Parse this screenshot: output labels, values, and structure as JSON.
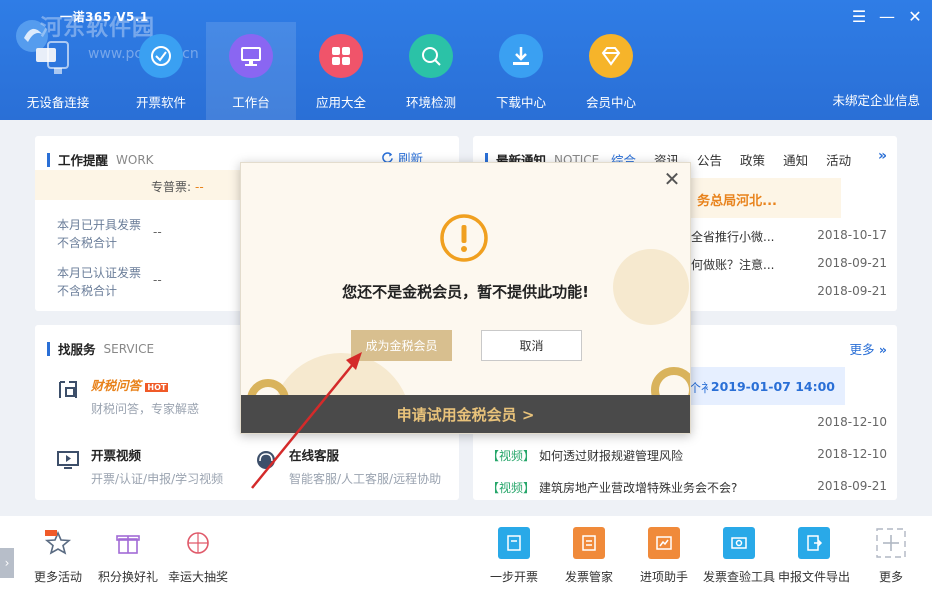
{
  "app": {
    "title": "一诺365 V5.1",
    "watermark": "河东软件园",
    "watermark_url": "www.pc0359.cn",
    "company_status": "未绑定企业信息"
  },
  "window_controls": {
    "menu": "☰",
    "minimize": "—",
    "close": "✕"
  },
  "nav": [
    {
      "label": "无设备连接",
      "icon": "device-icon"
    },
    {
      "label": "开票软件",
      "icon": "invoice-software-icon",
      "color": "#2f8fe8"
    },
    {
      "label": "工作台",
      "icon": "workbench-icon",
      "color": "#7b5cf0"
    },
    {
      "label": "应用大全",
      "icon": "apps-icon",
      "color": "#f0546a"
    },
    {
      "label": "环境检测",
      "icon": "env-check-icon",
      "color": "#2bc2a7"
    },
    {
      "label": "下载中心",
      "icon": "download-icon",
      "color": "#2f8fe8"
    },
    {
      "label": "会员中心",
      "icon": "vip-icon",
      "color": "#f6b42a"
    }
  ],
  "work": {
    "title": "工作提醒",
    "title_en": "WORK",
    "refresh": "刷新",
    "ticket_label": "专普票:",
    "ticket_value": "--",
    "stats": [
      {
        "line1": "本月已开具发票",
        "line2": "不含税合计",
        "value": "--"
      },
      {
        "line1": "本月已认证发票",
        "line2": "不含税合计",
        "value": "--"
      }
    ]
  },
  "service": {
    "title": "找服务",
    "title_en": "SERVICE",
    "items": [
      {
        "name": "财税问答",
        "badge": "HOT",
        "desc": "财税问答，专家解惑"
      },
      {
        "name": "开票视频",
        "desc": "开票/认证/申报/学习视频"
      },
      {
        "name": "在线客服",
        "desc": "智能客服/人工客服/远程协助"
      }
    ]
  },
  "notice": {
    "title": "最新通知",
    "title_en": "NOTICE",
    "tabs": [
      "综合",
      "资讯",
      "公告",
      "政策",
      "通知",
      "活动"
    ],
    "more": "»",
    "banner": "务总局河北...",
    "rows": [
      {
        "text": "全省推行小微...",
        "date": "2018-10-17"
      },
      {
        "text": "何做账？注意...",
        "date": "2018-09-21"
      },
      {
        "text": "",
        "date": "2018-09-21"
      }
    ]
  },
  "news": {
    "more": "更多",
    "live_marker": "个衤",
    "live_time": "2019-01-07 14:00",
    "rows": [
      {
        "tag": "",
        "text": "",
        "date": "2018-12-10"
      },
      {
        "tag": "【视频】",
        "text": "如何透过财报规避管理风险",
        "date": "2018-12-10"
      },
      {
        "tag": "【视频】",
        "text": "建筑房地产业营改增特殊业务会不会?",
        "date": "2018-09-21"
      }
    ]
  },
  "bottom_left": [
    {
      "label": "更多活动",
      "icon": "star-hot-icon",
      "badge": "HOT"
    },
    {
      "label": "积分换好礼",
      "icon": "gift-icon"
    },
    {
      "label": "幸运大抽奖",
      "icon": "lottery-wheel-icon"
    }
  ],
  "bottom_right": [
    {
      "label": "一步开票",
      "icon": "one-step-invoice-icon",
      "color": "#29a9e8"
    },
    {
      "label": "发票管家",
      "icon": "invoice-manager-icon",
      "color": "#f08a3a"
    },
    {
      "label": "进项助手",
      "icon": "input-tax-icon",
      "color": "#f08a3a"
    },
    {
      "label": "发票查验工具",
      "icon": "invoice-verify-icon",
      "color": "#29a9e8"
    },
    {
      "label": "申报文件导出",
      "icon": "export-file-icon",
      "color": "#29a9e8"
    },
    {
      "label": "更多",
      "icon": "plus-icon"
    }
  ],
  "modal": {
    "message": "您还不是金税会员，暂不提供此功能!",
    "primary_button": "成为金税会员",
    "cancel_button": "取消",
    "footer": "申请试用金税会员 >",
    "close": "✕"
  }
}
